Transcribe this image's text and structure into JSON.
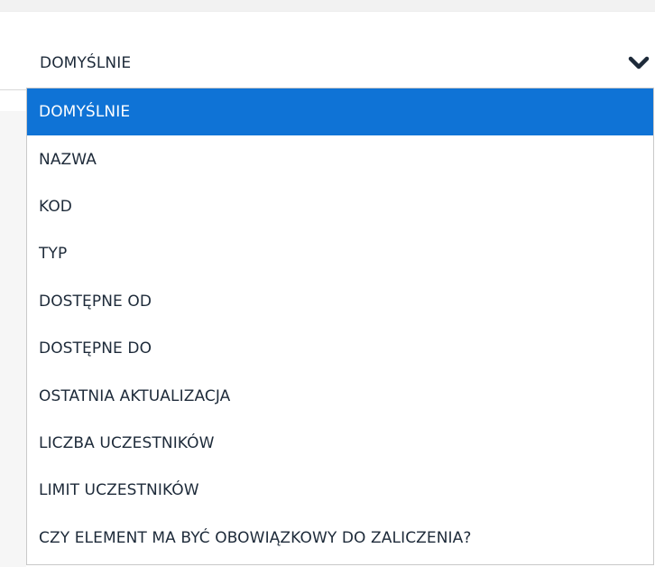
{
  "select": {
    "value": "DOMYŚLNIE",
    "toggle_icon": "chevron-down-icon"
  },
  "dropdown": {
    "selected_index": 0,
    "options": [
      {
        "label": "DOMYŚLNIE"
      },
      {
        "label": "NAZWA"
      },
      {
        "label": "KOD"
      },
      {
        "label": "TYP"
      },
      {
        "label": "DOSTĘPNE OD"
      },
      {
        "label": "DOSTĘPNE DO"
      },
      {
        "label": "OSTATNIA AKTUALIZACJA"
      },
      {
        "label": "LICZBA UCZESTNIKÓW"
      },
      {
        "label": "LIMIT UCZESTNIKÓW"
      },
      {
        "label": "CZY ELEMENT MA BYĆ OBOWIĄZKOWY DO ZALICZENIA?"
      }
    ]
  },
  "colors": {
    "selected_background": "#0f73d6",
    "selected_text": "#ffffff",
    "option_text": "#1d2a39",
    "list_border": "#c9c9c9"
  }
}
